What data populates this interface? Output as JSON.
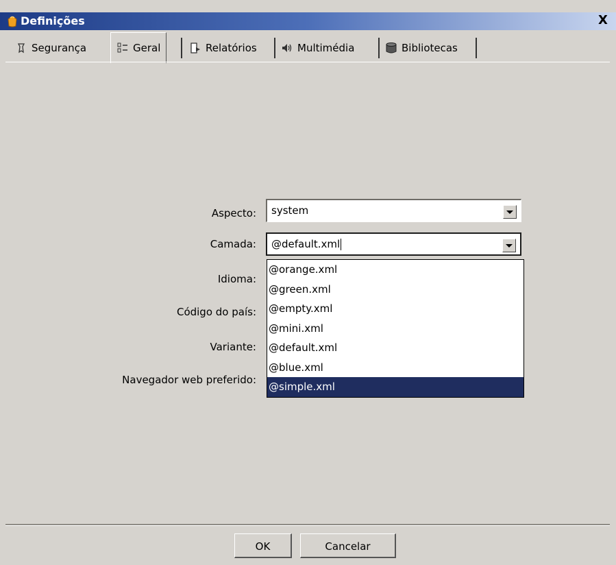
{
  "window": {
    "title": "Definições",
    "close_glyph": "X"
  },
  "tabs": [
    {
      "label": "Segurança",
      "icon": "security-icon"
    },
    {
      "label": "Geral",
      "icon": "general-settings-icon",
      "active": true
    },
    {
      "label": "Relatórios",
      "icon": "reports-icon"
    },
    {
      "label": "Multimédia",
      "icon": "speaker-icon"
    },
    {
      "label": "Bibliotecas",
      "icon": "database-icon"
    }
  ],
  "form": {
    "aspecto": {
      "label": "Aspecto:",
      "value": "system"
    },
    "camada": {
      "label": "Camada:",
      "value": "@default.xml"
    },
    "idioma": {
      "label": "Idioma:"
    },
    "codigo_pais": {
      "label": "Código do país:"
    },
    "variante": {
      "label": "Variante:"
    },
    "navegador": {
      "label": "Navegador web preferido:"
    }
  },
  "dropdown": {
    "options": [
      "@orange.xml",
      "@green.xml",
      "@empty.xml",
      "@mini.xml",
      "@default.xml",
      "@blue.xml",
      "@simple.xml"
    ],
    "highlighted": "@simple.xml"
  },
  "buttons": {
    "ok": "OK",
    "cancel": "Cancelar"
  },
  "colors": {
    "titlebar": "#1d3b86",
    "selection": "#1f2d5f",
    "background": "#d6d3ce"
  }
}
